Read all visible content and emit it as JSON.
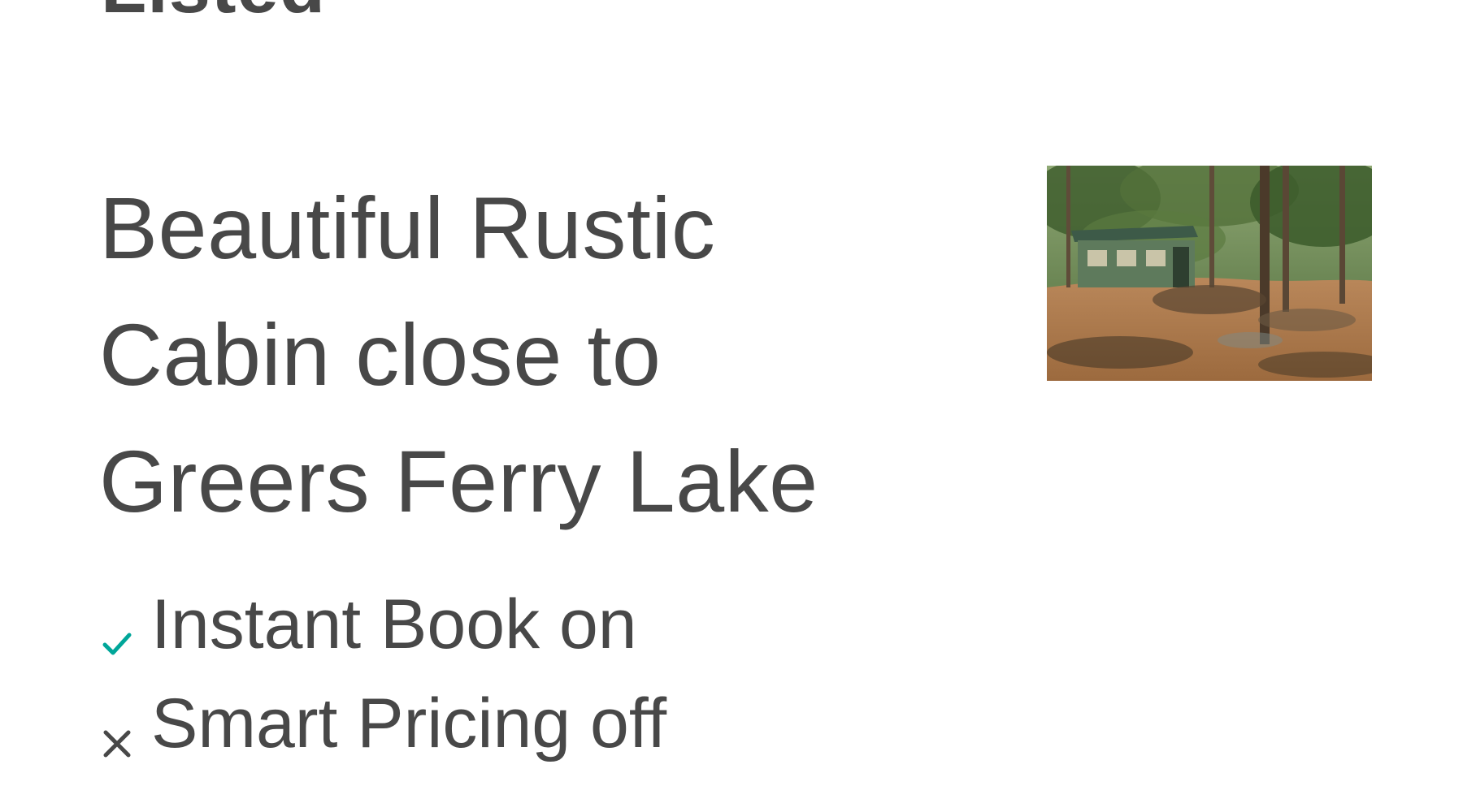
{
  "section": {
    "heading": "Listed"
  },
  "listing": {
    "title": "Beautiful Rustic Cabin close to Greers Ferry Lake",
    "photo_icon": "cabin-photo",
    "statuses": [
      {
        "label": "Instant Book on",
        "icon": "check-icon",
        "enabled": true
      },
      {
        "label": "Smart Pricing off",
        "icon": "x-icon",
        "enabled": false
      }
    ]
  },
  "colors": {
    "text": "#484848",
    "check": "#00a699",
    "x": "#484848",
    "background": "#ffffff"
  }
}
